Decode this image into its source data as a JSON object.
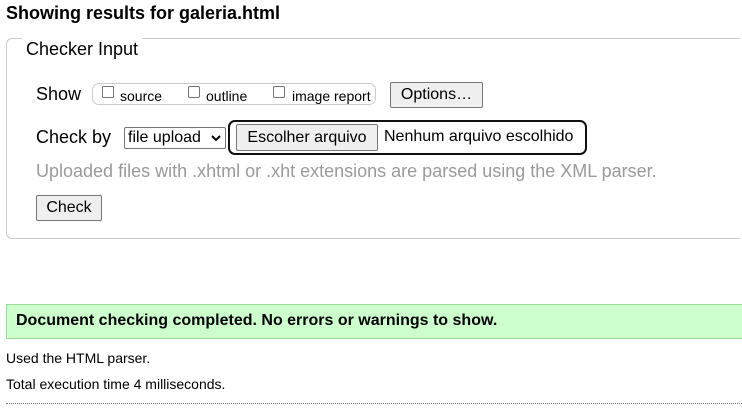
{
  "page": {
    "title": "Showing results for galeria.html"
  },
  "checker": {
    "legend": "Checker Input",
    "show_label": "Show",
    "options": [
      {
        "label": "source",
        "checked": false
      },
      {
        "label": "outline",
        "checked": false
      },
      {
        "label": "image report",
        "checked": false
      }
    ],
    "options_button": "Options…",
    "check_by_label": "Check by",
    "check_by_value": "file upload",
    "choose_file_button": "Escolher arquivo",
    "file_status": "Nenhum arquivo escolhido",
    "hint": "Uploaded files with .xhtml or .xht extensions are parsed using the XML parser.",
    "check_button": "Check"
  },
  "results": {
    "message": "Document checking completed. No errors or warnings to show.",
    "parser_info": "Used the HTML parser.",
    "execution_time": "Total execution time 4 milliseconds."
  },
  "colors": {
    "success_background": "#ccffcc",
    "hint_text": "#9a9a9a"
  },
  "icons": {
    "select_arrow": "chevron-down-icon"
  }
}
